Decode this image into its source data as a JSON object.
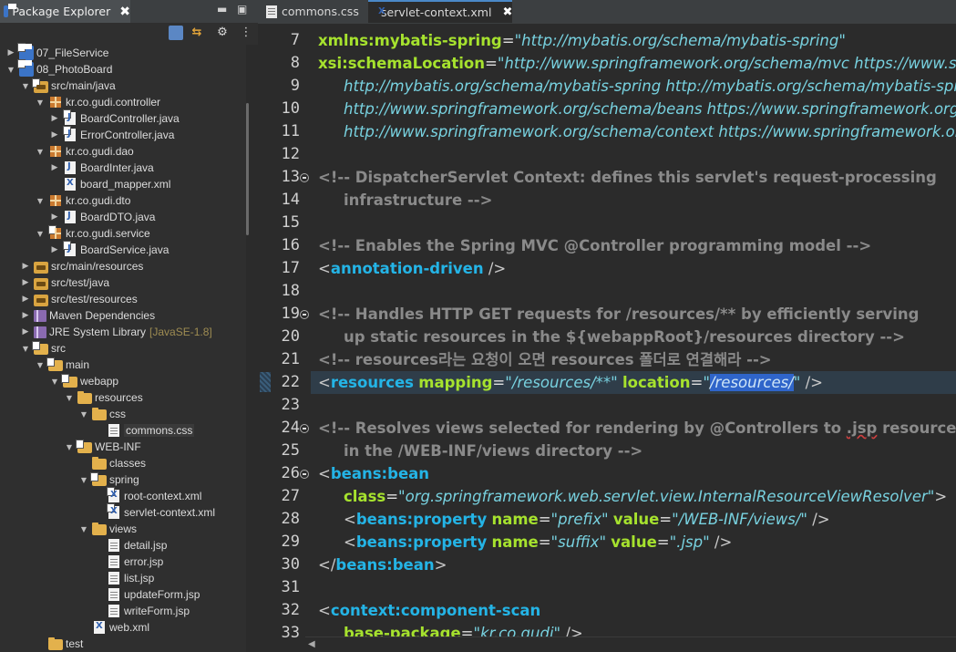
{
  "explorer": {
    "title": "Package Explorer",
    "close_glyph": "✖",
    "minimize_glyph": "▬",
    "maximize_glyph": "▣",
    "tree": [
      {
        "label": "07_FileService",
        "indent": 0,
        "arrow": ">",
        "icon": "project-icon",
        "svn": true
      },
      {
        "label": "08_PhotoBoard",
        "indent": 0,
        "arrow": "v",
        "icon": "project-icon",
        "svn": true
      },
      {
        "label": "src/main/java",
        "indent": 1,
        "arrow": "v",
        "icon": "source-folder-icon",
        "svn": true
      },
      {
        "label": "kr.co.gudi.controller",
        "indent": 2,
        "arrow": "v",
        "icon": "package-icon"
      },
      {
        "label": "BoardController.java",
        "indent": 3,
        "arrow": ">",
        "icon": "java-file-icon",
        "svn": true
      },
      {
        "label": "ErrorController.java",
        "indent": 3,
        "arrow": ">",
        "icon": "java-file-icon",
        "svn": true
      },
      {
        "label": "kr.co.gudi.dao",
        "indent": 2,
        "arrow": "v",
        "icon": "package-icon"
      },
      {
        "label": "BoardInter.java",
        "indent": 3,
        "arrow": ">",
        "icon": "java-interface-icon"
      },
      {
        "label": "board_mapper.xml",
        "indent": 3,
        "arrow": "",
        "icon": "xml-file-icon"
      },
      {
        "label": "kr.co.gudi.dto",
        "indent": 2,
        "arrow": "v",
        "icon": "package-icon"
      },
      {
        "label": "BoardDTO.java",
        "indent": 3,
        "arrow": ">",
        "icon": "java-file-icon"
      },
      {
        "label": "kr.co.gudi.service",
        "indent": 2,
        "arrow": "v",
        "icon": "package-icon",
        "svn": true
      },
      {
        "label": "BoardService.java",
        "indent": 3,
        "arrow": ">",
        "icon": "java-file-icon",
        "svn": true
      },
      {
        "label": "src/main/resources",
        "indent": 1,
        "arrow": ">",
        "icon": "source-folder-icon"
      },
      {
        "label": "src/test/java",
        "indent": 1,
        "arrow": ">",
        "icon": "source-folder-icon"
      },
      {
        "label": "src/test/resources",
        "indent": 1,
        "arrow": ">",
        "icon": "source-folder-icon"
      },
      {
        "label": "Maven Dependencies",
        "indent": 1,
        "arrow": ">",
        "icon": "library-icon"
      },
      {
        "label": "JRE System Library",
        "suffix": "[JavaSE-1.8]",
        "indent": 1,
        "arrow": ">",
        "icon": "library-icon"
      },
      {
        "label": "src",
        "indent": 1,
        "arrow": "v",
        "icon": "folder-icon",
        "svn": true
      },
      {
        "label": "main",
        "indent": 2,
        "arrow": "v",
        "icon": "folder-icon",
        "svn": true
      },
      {
        "label": "webapp",
        "indent": 3,
        "arrow": "v",
        "icon": "folder-icon",
        "svn": true
      },
      {
        "label": "resources",
        "indent": 4,
        "arrow": "v",
        "icon": "folder-icon"
      },
      {
        "label": "css",
        "indent": 5,
        "arrow": "v",
        "icon": "folder-icon"
      },
      {
        "label": "commons.css",
        "indent": 6,
        "arrow": "",
        "icon": "css-file-icon",
        "selected": true
      },
      {
        "label": "WEB-INF",
        "indent": 4,
        "arrow": "v",
        "icon": "folder-icon",
        "svn": true
      },
      {
        "label": "classes",
        "indent": 5,
        "arrow": "",
        "icon": "folder-icon"
      },
      {
        "label": "spring",
        "indent": 5,
        "arrow": "v",
        "icon": "folder-icon",
        "svn": true
      },
      {
        "label": "root-context.xml",
        "indent": 6,
        "arrow": "",
        "icon": "xml-file-icon",
        "svn": true
      },
      {
        "label": "servlet-context.xml",
        "indent": 6,
        "arrow": "",
        "icon": "xml-file-icon",
        "svn": true
      },
      {
        "label": "views",
        "indent": 5,
        "arrow": "v",
        "icon": "folder-icon"
      },
      {
        "label": "detail.jsp",
        "indent": 6,
        "arrow": "",
        "icon": "jsp-file-icon"
      },
      {
        "label": "error.jsp",
        "indent": 6,
        "arrow": "",
        "icon": "jsp-file-icon"
      },
      {
        "label": "list.jsp",
        "indent": 6,
        "arrow": "",
        "icon": "jsp-file-icon"
      },
      {
        "label": "updateForm.jsp",
        "indent": 6,
        "arrow": "",
        "icon": "jsp-file-icon"
      },
      {
        "label": "writeForm.jsp",
        "indent": 6,
        "arrow": "",
        "icon": "jsp-file-icon"
      },
      {
        "label": "web.xml",
        "indent": 5,
        "arrow": "",
        "icon": "xml-file-icon"
      },
      {
        "label": "test",
        "indent": 2,
        "arrow": "",
        "icon": "folder-icon"
      }
    ]
  },
  "editor": {
    "tabs": [
      {
        "label": "commons.css",
        "active": false
      },
      {
        "label": "servlet-context.xml",
        "active": true
      }
    ],
    "current_line": 22,
    "lines": [
      {
        "n": 7,
        "tokens": [
          [
            "attr",
            "xmlns:mybatis-spring"
          ],
          [
            "eq",
            "="
          ],
          [
            "val",
            "\"http://mybatis.org/schema/mybatis-spring\""
          ]
        ],
        "indent": 0
      },
      {
        "n": 8,
        "tokens": [
          [
            "attr",
            "xsi:schemaLocation"
          ],
          [
            "eq",
            "="
          ],
          [
            "val",
            "\"http://www.springframework.org/schema/mvc https://www.springframework.org/schema/mvc/spring-mvc.xsd"
          ]
        ],
        "indent": 0
      },
      {
        "n": 9,
        "tokens": [
          [
            "val",
            "http://mybatis.org/schema/mybatis-spring http://mybatis.org/schema/mybatis-spring.xsd"
          ]
        ],
        "indent": 1
      },
      {
        "n": 10,
        "tokens": [
          [
            "val",
            "http://www.springframework.org/schema/beans https://www.springframework.org/schema/beans/spring-beans.xsd"
          ]
        ],
        "indent": 1
      },
      {
        "n": 11,
        "tokens": [
          [
            "val",
            "http://www.springframework.org/schema/context https://www.springframework.org/schema/context/spring-context.xsd\">"
          ]
        ],
        "indent": 1
      },
      {
        "n": 12,
        "tokens": [],
        "indent": 0
      },
      {
        "n": 13,
        "fold": true,
        "tokens": [
          [
            "comment",
            "<!-- DispatcherServlet Context: defines this servlet's request-processing"
          ]
        ],
        "indent": 0
      },
      {
        "n": 14,
        "tokens": [
          [
            "comment",
            "infrastructure -->"
          ]
        ],
        "indent": 1
      },
      {
        "n": 15,
        "tokens": [],
        "indent": 0
      },
      {
        "n": 16,
        "tokens": [
          [
            "comment",
            "<!-- Enables the Spring MVC @Controller programming model -->"
          ]
        ],
        "indent": 0
      },
      {
        "n": 17,
        "tokens": [
          [
            "bracket",
            "<"
          ],
          [
            "tag",
            "annotation-driven"
          ],
          [
            "bracket",
            " />"
          ]
        ],
        "indent": 0
      },
      {
        "n": 18,
        "tokens": [],
        "indent": 0
      },
      {
        "n": 19,
        "fold": true,
        "tokens": [
          [
            "comment",
            "<!-- Handles HTTP GET requests for /resources/** by efficiently serving"
          ]
        ],
        "indent": 0
      },
      {
        "n": 20,
        "tokens": [
          [
            "comment",
            "up static resources in the ${webappRoot}/resources directory -->"
          ]
        ],
        "indent": 1
      },
      {
        "n": 21,
        "tokens": [
          [
            "comment",
            "<!-- resources라는 요청이 오면 resources 폴더로 연결해라 -->"
          ]
        ],
        "indent": 0
      },
      {
        "n": 22,
        "tokens": [
          [
            "bracket",
            "<"
          ],
          [
            "tag",
            "resources"
          ],
          [
            "text",
            " "
          ],
          [
            "attr",
            "mapping"
          ],
          [
            "eq",
            "="
          ],
          [
            "val",
            "\"/resources/**\""
          ],
          [
            "text",
            " "
          ],
          [
            "attr",
            "location"
          ],
          [
            "eq",
            "="
          ],
          [
            "val",
            "\""
          ],
          [
            "sel",
            "/resources/"
          ],
          [
            "val",
            "\""
          ],
          [
            "bracket",
            " />"
          ]
        ],
        "indent": 0
      },
      {
        "n": 23,
        "tokens": [],
        "indent": 0
      },
      {
        "n": 24,
        "fold": true,
        "tokens": [
          [
            "comment",
            "<!-- Resolves views selected for rendering by @Controllers to "
          ],
          [
            "squig",
            ".jsp"
          ],
          [
            "comment",
            " resources"
          ]
        ],
        "indent": 0
      },
      {
        "n": 25,
        "tokens": [
          [
            "comment",
            "in the /WEB-INF/views directory -->"
          ]
        ],
        "indent": 1
      },
      {
        "n": 26,
        "fold": true,
        "tokens": [
          [
            "bracket",
            "<"
          ],
          [
            "tag",
            "beans:bean"
          ]
        ],
        "indent": 0
      },
      {
        "n": 27,
        "tokens": [
          [
            "attr",
            "class"
          ],
          [
            "eq",
            "="
          ],
          [
            "val",
            "\"org.springframework.web.servlet.view.InternalResourceViewResolver\""
          ],
          [
            "bracket",
            ">"
          ]
        ],
        "indent": 1
      },
      {
        "n": 28,
        "tokens": [
          [
            "bracket",
            "<"
          ],
          [
            "tag",
            "beans:property"
          ],
          [
            "text",
            " "
          ],
          [
            "attr",
            "name"
          ],
          [
            "eq",
            "="
          ],
          [
            "val",
            "\"prefix\""
          ],
          [
            "text",
            " "
          ],
          [
            "attr",
            "value"
          ],
          [
            "eq",
            "="
          ],
          [
            "val",
            "\"/WEB-INF/views/\""
          ],
          [
            "bracket",
            " />"
          ]
        ],
        "indent": 1
      },
      {
        "n": 29,
        "tokens": [
          [
            "bracket",
            "<"
          ],
          [
            "tag",
            "beans:property"
          ],
          [
            "text",
            " "
          ],
          [
            "attr",
            "name"
          ],
          [
            "eq",
            "="
          ],
          [
            "val",
            "\"suffix\""
          ],
          [
            "text",
            " "
          ],
          [
            "attr",
            "value"
          ],
          [
            "eq",
            "="
          ],
          [
            "val",
            "\".jsp\""
          ],
          [
            "bracket",
            " />"
          ]
        ],
        "indent": 1
      },
      {
        "n": 30,
        "tokens": [
          [
            "bracket",
            "</"
          ],
          [
            "tag",
            "beans:bean"
          ],
          [
            "bracket",
            ">"
          ]
        ],
        "indent": 0
      },
      {
        "n": 31,
        "tokens": [],
        "indent": 0
      },
      {
        "n": 32,
        "tokens": [
          [
            "bracket",
            "<"
          ],
          [
            "tag",
            "context:component-scan"
          ]
        ],
        "indent": 0
      },
      {
        "n": 33,
        "tokens": [
          [
            "attr",
            "base-package"
          ],
          [
            "eq",
            "="
          ],
          [
            "val",
            "\"kr.co.gudi\""
          ],
          [
            "bracket",
            " />"
          ]
        ],
        "indent": 1
      }
    ]
  }
}
